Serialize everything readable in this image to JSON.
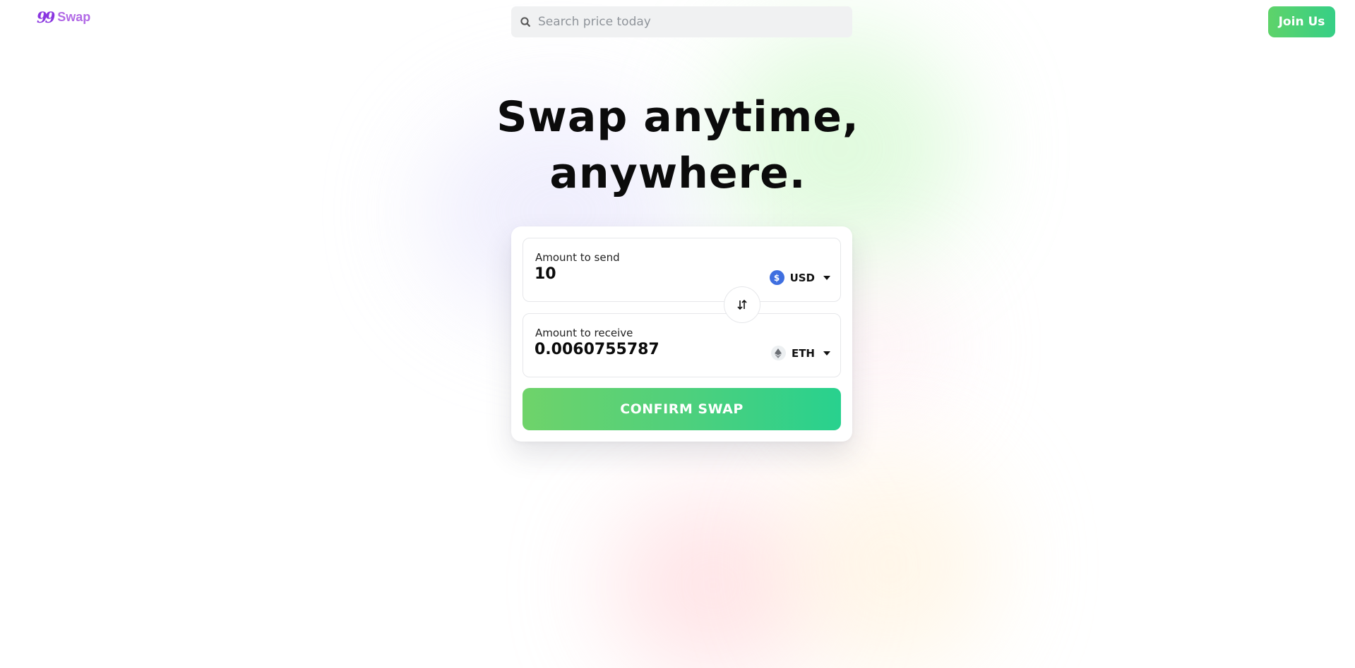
{
  "header": {
    "logo_mark": "99",
    "logo_text": "Swap",
    "search_placeholder": "Search price today",
    "join_label": "Join Us"
  },
  "hero": {
    "title_line1": "Swap anytime,",
    "title_line2": "anywhere."
  },
  "swap": {
    "send": {
      "label": "Amount to send",
      "value": "10",
      "currency": "USD",
      "currency_icon": "dollar-coin-icon",
      "currency_symbol": "$"
    },
    "receive": {
      "label": "Amount to receive",
      "value": "0.0060755787",
      "currency": "ETH",
      "currency_icon": "ethereum-icon"
    },
    "toggle_icon": "swap-arrows-icon",
    "confirm_label": "CONFIRM SWAP"
  },
  "colors": {
    "brand_purple": "#8a36e0",
    "accent_green_start": "#6fd36a",
    "accent_green_end": "#28d18e",
    "usd_blue": "#3f6fe0"
  }
}
